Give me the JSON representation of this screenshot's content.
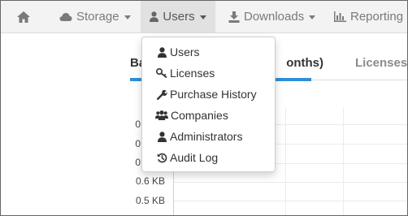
{
  "colors": {
    "navbar_bg": "#f3f3f3",
    "active_bg": "#e1e1e1",
    "accent": "#2f8fd8",
    "nav_text": "#7a7a7a"
  },
  "navbar": {
    "items": [
      {
        "label": "",
        "icon": "home-icon"
      },
      {
        "label": "Storage",
        "icon": "cloud-icon",
        "has_caret": true
      },
      {
        "label": "Users",
        "icon": "user-icon",
        "has_caret": true,
        "active": true
      },
      {
        "label": "Downloads",
        "icon": "download-icon",
        "has_caret": true
      },
      {
        "label": "Reporting",
        "icon": "bar-chart-icon",
        "has_caret": true
      }
    ]
  },
  "dropdown": {
    "items": [
      {
        "label": "Users",
        "icon": "user-icon"
      },
      {
        "label": "Licenses",
        "icon": "key-icon"
      },
      {
        "label": "Purchase History",
        "icon": "wrench-icon"
      },
      {
        "label": "Companies",
        "icon": "users-icon"
      },
      {
        "label": "Administrators",
        "icon": "user-icon"
      },
      {
        "label": "Audit Log",
        "icon": "history-icon"
      }
    ]
  },
  "tabs": {
    "left_visible_start": "Ba",
    "left_visible_end": "onths)",
    "right": "Licenses"
  },
  "chart": {
    "tick_labels": [
      "0",
      "0",
      "0",
      "0.6 KB",
      "0.5 KB"
    ]
  }
}
